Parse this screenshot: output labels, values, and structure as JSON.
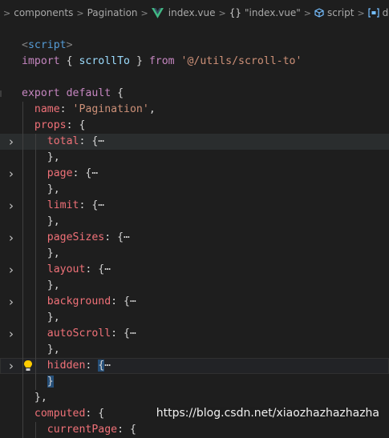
{
  "breadcrumb": {
    "items": [
      "components",
      "Pagination",
      "index.vue",
      "\"index.vue\"",
      "script",
      "defaul"
    ],
    "separator": ">"
  },
  "code": {
    "lines": [
      {
        "tokens": [
          {
            "t": "<",
            "c": "tag"
          },
          {
            "t": "script",
            "c": "tagname"
          },
          {
            "t": ">",
            "c": "tag"
          }
        ]
      },
      {
        "tokens": [
          {
            "t": "import",
            "c": "kw"
          },
          {
            "t": " { ",
            "c": "punc"
          },
          {
            "t": "scrollTo",
            "c": "var"
          },
          {
            "t": " } ",
            "c": "punc"
          },
          {
            "t": "from",
            "c": "kw"
          },
          {
            "t": " ",
            "c": "punc"
          },
          {
            "t": "'@/utils/scroll-to'",
            "c": "str"
          }
        ]
      },
      {
        "tokens": []
      },
      {
        "tokens": [
          {
            "t": "export",
            "c": "kw"
          },
          {
            "t": " ",
            "c": "punc"
          },
          {
            "t": "default",
            "c": "kw"
          },
          {
            "t": " {",
            "c": "punc"
          }
        ]
      },
      {
        "tokens": [
          {
            "t": "  name",
            "c": "prop"
          },
          {
            "t": ": ",
            "c": "punc"
          },
          {
            "t": "'Pagination'",
            "c": "str"
          },
          {
            "t": ",",
            "c": "punc"
          }
        ]
      },
      {
        "tokens": [
          {
            "t": "  props",
            "c": "prop"
          },
          {
            "t": ": {",
            "c": "punc"
          }
        ]
      },
      {
        "fold": true,
        "hl": true,
        "tokens": [
          {
            "t": "    total",
            "c": "prop"
          },
          {
            "t": ": {",
            "c": "punc"
          },
          {
            "t": "⋯",
            "c": "ell"
          }
        ]
      },
      {
        "tokens": [
          {
            "t": "    },",
            "c": "punc"
          }
        ]
      },
      {
        "fold": true,
        "tokens": [
          {
            "t": "    page",
            "c": "prop"
          },
          {
            "t": ": {",
            "c": "punc"
          },
          {
            "t": "⋯",
            "c": "ell"
          }
        ]
      },
      {
        "tokens": [
          {
            "t": "    },",
            "c": "punc"
          }
        ]
      },
      {
        "fold": true,
        "tokens": [
          {
            "t": "    limit",
            "c": "prop"
          },
          {
            "t": ": {",
            "c": "punc"
          },
          {
            "t": "⋯",
            "c": "ell"
          }
        ]
      },
      {
        "tokens": [
          {
            "t": "    },",
            "c": "punc"
          }
        ]
      },
      {
        "fold": true,
        "tokens": [
          {
            "t": "    pageSizes",
            "c": "prop"
          },
          {
            "t": ": {",
            "c": "punc"
          },
          {
            "t": "⋯",
            "c": "ell"
          }
        ]
      },
      {
        "tokens": [
          {
            "t": "    },",
            "c": "punc"
          }
        ]
      },
      {
        "fold": true,
        "tokens": [
          {
            "t": "    layout",
            "c": "prop"
          },
          {
            "t": ": {",
            "c": "punc"
          },
          {
            "t": "⋯",
            "c": "ell"
          }
        ]
      },
      {
        "tokens": [
          {
            "t": "    },",
            "c": "punc"
          }
        ]
      },
      {
        "fold": true,
        "tokens": [
          {
            "t": "    background",
            "c": "prop"
          },
          {
            "t": ": {",
            "c": "punc"
          },
          {
            "t": "⋯",
            "c": "ell"
          }
        ]
      },
      {
        "tokens": [
          {
            "t": "    },",
            "c": "punc"
          }
        ]
      },
      {
        "fold": true,
        "tokens": [
          {
            "t": "    autoScroll",
            "c": "prop"
          },
          {
            "t": ": {",
            "c": "punc"
          },
          {
            "t": "⋯",
            "c": "ell"
          }
        ]
      },
      {
        "tokens": [
          {
            "t": "    },",
            "c": "punc"
          }
        ]
      },
      {
        "fold": true,
        "cur": true,
        "bulb": true,
        "tokens": [
          {
            "t": "    hidden",
            "c": "prop"
          },
          {
            "t": ": ",
            "c": "punc"
          },
          {
            "t": "{",
            "c": "punc sel"
          },
          {
            "t": "⋯",
            "c": "ell"
          }
        ]
      },
      {
        "tokens": [
          {
            "t": "    ",
            "c": "punc"
          },
          {
            "t": "}",
            "c": "punc sel"
          }
        ]
      },
      {
        "tokens": [
          {
            "t": "  },",
            "c": "punc"
          }
        ]
      },
      {
        "tokens": [
          {
            "t": "  computed",
            "c": "prop"
          },
          {
            "t": ": {",
            "c": "punc"
          }
        ]
      },
      {
        "tokens": [
          {
            "t": "    currentPage",
            "c": "prop"
          },
          {
            "t": ": {",
            "c": "punc"
          }
        ]
      }
    ]
  },
  "watermark": "https://blog.csdn.net/xiaozhazhazhazha"
}
